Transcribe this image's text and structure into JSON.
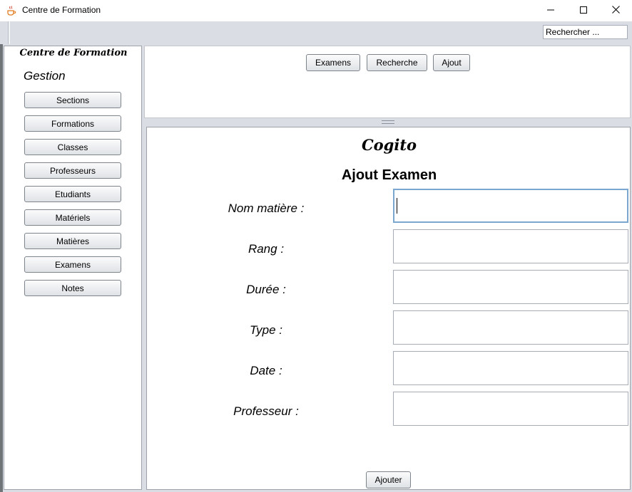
{
  "window": {
    "title": "Centre de Formation"
  },
  "toolbar": {
    "search_placeholder": "Rechercher ..."
  },
  "sidebar": {
    "title": "Centre de Formation",
    "heading": "Gestion",
    "items": [
      {
        "label": "Sections"
      },
      {
        "label": "Formations"
      },
      {
        "label": "Classes"
      },
      {
        "label": "Professeurs"
      },
      {
        "label": "Etudiants"
      },
      {
        "label": "Matériels"
      },
      {
        "label": "Matières"
      },
      {
        "label": "Examens"
      },
      {
        "label": "Notes"
      }
    ]
  },
  "top_nav": {
    "buttons": [
      {
        "label": "Examens"
      },
      {
        "label": "Recherche"
      },
      {
        "label": "Ajout"
      }
    ]
  },
  "form": {
    "brand": "Cogito",
    "heading": "Ajout Examen",
    "fields": [
      {
        "label": "Nom matière :",
        "value": ""
      },
      {
        "label": "Rang :",
        "value": ""
      },
      {
        "label": "Durée :",
        "value": ""
      },
      {
        "label": "Type :",
        "value": ""
      },
      {
        "label": "Date :",
        "value": ""
      },
      {
        "label": "Professeur :",
        "value": ""
      }
    ],
    "submit_label": "Ajouter"
  },
  "icons": {
    "app": "java-cup-icon",
    "minimize": "minimize-icon",
    "maximize": "maximize-icon",
    "close": "close-icon"
  },
  "colors": {
    "chrome": "#dadde3",
    "focus_border": "#7aa7d0",
    "app_icon": "#e07b1f"
  }
}
